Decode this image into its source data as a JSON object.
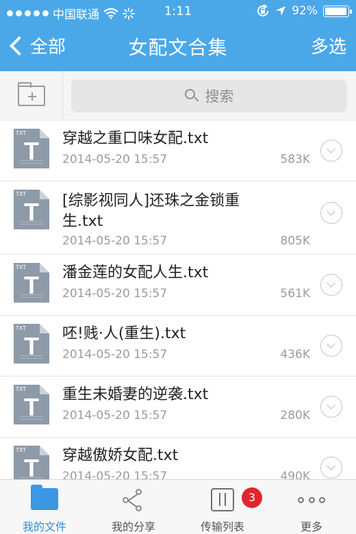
{
  "status_bar": {
    "carrier": "中国联通",
    "time": "1:11",
    "battery_percent": "92%",
    "battery_level": 0.92,
    "icons": [
      "signal-dots",
      "wifi-icon",
      "loading-icon",
      "rotation-lock-icon",
      "location-arrow-icon",
      "battery-icon"
    ]
  },
  "nav": {
    "back_label": "全部",
    "title": "女配文合集",
    "action_label": "多选"
  },
  "toolbar": {
    "search_placeholder": "搜索",
    "new_folder_icon": "new-folder-icon"
  },
  "files": [
    {
      "name": "穿越之重口味女配.txt",
      "date": "2014-05-20 15:57",
      "size": "583K",
      "type": "TXT",
      "glyph": "T"
    },
    {
      "name": "[综影视同人]还珠之金锁重生.txt",
      "date": "2014-05-20 15:57",
      "size": "805K",
      "type": "TXT",
      "glyph": "T"
    },
    {
      "name": "潘金莲的女配人生.txt",
      "date": "2014-05-20 15:57",
      "size": "561K",
      "type": "TXT",
      "glyph": "T"
    },
    {
      "name": "呸!贱·人(重生).txt",
      "date": "2014-05-20 15:57",
      "size": "436K",
      "type": "TXT",
      "glyph": "T"
    },
    {
      "name": "重生未婚妻的逆袭.txt",
      "date": "2014-05-20 15:57",
      "size": "280K",
      "type": "TXT",
      "glyph": "T"
    },
    {
      "name": "穿越傲娇女配.txt",
      "date": "2014-05-20 15:57",
      "size": "490K",
      "type": "TXT",
      "glyph": "T"
    }
  ],
  "tabbar": {
    "tabs": [
      {
        "label": "我的文件",
        "icon": "folder-icon",
        "active": true
      },
      {
        "label": "我的分享",
        "icon": "share-icon",
        "active": false
      },
      {
        "label": "传输列表",
        "icon": "transfer-list-icon",
        "active": false,
        "badge": "3"
      },
      {
        "label": "更多",
        "icon": "more-icon",
        "active": false
      }
    ]
  },
  "colors": {
    "header": "#4aa8e9",
    "active_tab": "#2f8fde",
    "badge": "#e3242b",
    "file_icon": "#8d9aa8"
  }
}
